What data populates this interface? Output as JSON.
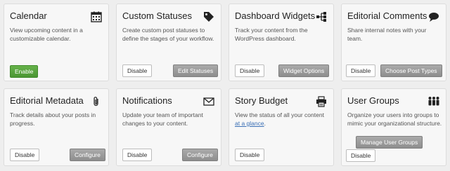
{
  "modules": [
    {
      "title": "Calendar",
      "icon": "calendar-icon",
      "description": "View upcoming content in a customizable calendar.",
      "buttons": {
        "enable": "Enable"
      }
    },
    {
      "title": "Custom Statuses",
      "icon": "tag-icon",
      "description": "Create custom post statuses to define the stages of your workflow.",
      "buttons": {
        "disable": "Disable",
        "action": "Edit Statuses"
      }
    },
    {
      "title": "Dashboard Widgets",
      "icon": "sitemap-icon",
      "description": "Track your content from the WordPress dashboard.",
      "buttons": {
        "disable": "Disable",
        "action": "Widget Options"
      }
    },
    {
      "title": "Editorial Comments",
      "icon": "speech-bubble-icon",
      "description": "Share internal notes with your team.",
      "buttons": {
        "disable": "Disable",
        "action": "Choose Post Types"
      }
    },
    {
      "title": "Editorial Metadata",
      "icon": "paperclip-icon",
      "description": "Track details about your posts in progress.",
      "buttons": {
        "disable": "Disable",
        "action": "Configure"
      }
    },
    {
      "title": "Notifications",
      "icon": "envelope-icon",
      "description": "Update your team of important changes to your content.",
      "buttons": {
        "disable": "Disable",
        "action": "Configure"
      }
    },
    {
      "title": "Story Budget",
      "icon": "printer-icon",
      "description_prefix": "View the status of all your content ",
      "description_link": "at a glance",
      "description_suffix": ".",
      "buttons": {
        "disable": "Disable"
      }
    },
    {
      "title": "User Groups",
      "icon": "users-icon",
      "description": "Organize your users into groups to mimic your organizational structure.",
      "buttons": {
        "action": "Manage User Groups",
        "disable": "Disable"
      }
    }
  ],
  "colors": {
    "enable_green": "#56a23c",
    "gray_button": "#999999",
    "link_blue": "#3a6fb5"
  }
}
